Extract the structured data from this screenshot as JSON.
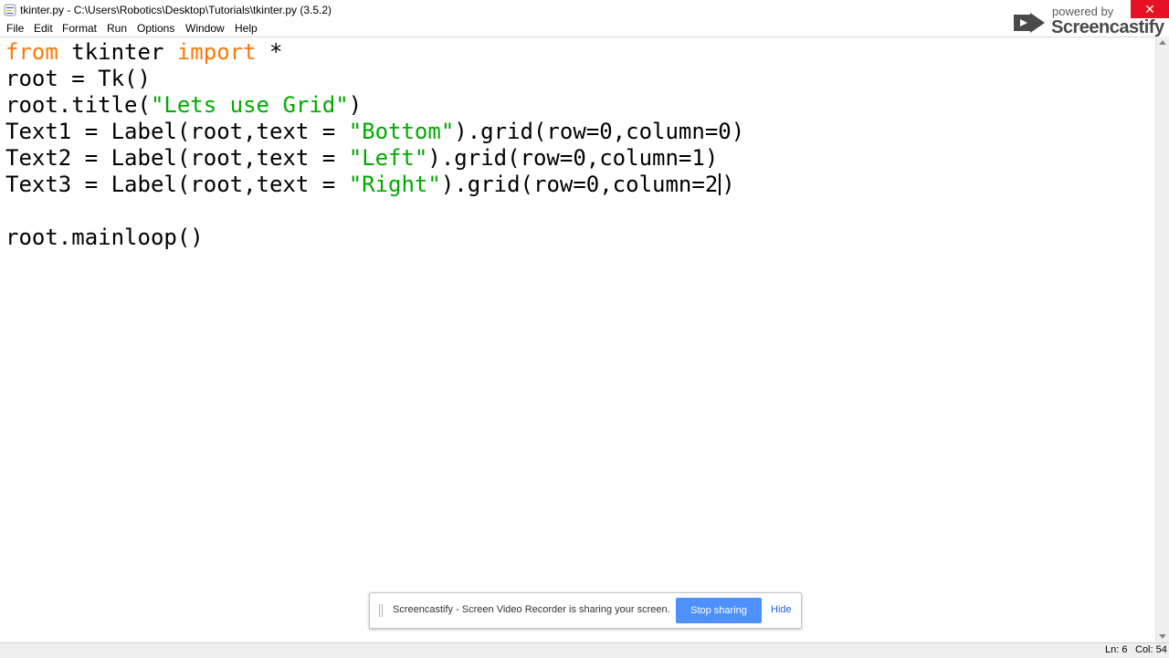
{
  "window": {
    "title": "tkinter.py - C:\\Users\\Robotics\\Desktop\\Tutorials\\tkinter.py (3.5.2)",
    "close_icon": "close-icon",
    "close_color": "#e81123"
  },
  "menu": {
    "items": [
      "File",
      "Edit",
      "Format",
      "Run",
      "Options",
      "Window",
      "Help"
    ]
  },
  "editor": {
    "colors": {
      "keyword": "#ff7700",
      "string": "#00aa00",
      "text": "#000000"
    },
    "lines": {
      "l1": {
        "kw1": "from",
        "t1": " tkinter ",
        "kw2": "import",
        "t2": " *"
      },
      "l2": {
        "t1": "root = Tk()"
      },
      "l3": {
        "t1": "root.title(",
        "s1": "\"Lets use Grid\"",
        "t2": ")"
      },
      "l4": {
        "t1": "Text1 = Label(root,text = ",
        "s1": "\"Bottom\"",
        "t2": ").grid(row=0,column=0)"
      },
      "l5": {
        "t1": "Text2 = Label(root,text = ",
        "s1": "\"Left\"",
        "t2": ").grid(row=0,column=1)"
      },
      "l6": {
        "t1": "Text3 = Label(root,text = ",
        "s1": "\"Right\"",
        "t2": ").grid(row=0,column=2",
        "t3": ")"
      },
      "l7": {
        "t1": ""
      },
      "l8": {
        "t1": "root.mainloop()"
      }
    }
  },
  "status": {
    "line": "Ln: 6",
    "col": "Col: 54"
  },
  "watermark": {
    "powered_by": "powered by",
    "brand": "Screencastify"
  },
  "share_bar": {
    "message": "Screencastify - Screen Video Recorder is sharing your screen.",
    "stop_label": "Stop sharing",
    "hide_label": "Hide",
    "button_color": "#4d90fe"
  }
}
